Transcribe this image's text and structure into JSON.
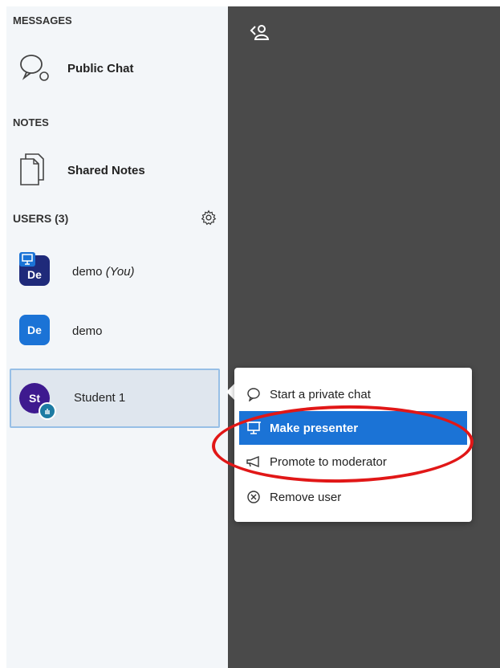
{
  "sidebar": {
    "messages_title": "MESSAGES",
    "public_chat_label": "Public Chat",
    "notes_title": "NOTES",
    "shared_notes_label": "Shared Notes",
    "users_title": "USERS (3)",
    "users": [
      {
        "initials": "De",
        "name": "demo",
        "suffix": "(You)",
        "color": "#1f2a7a"
      },
      {
        "initials": "De",
        "name": "demo",
        "suffix": "",
        "color": "#1b73d6"
      },
      {
        "initials": "St",
        "name": "Student 1",
        "suffix": "",
        "color": "#3e1a8f"
      }
    ]
  },
  "context_menu": {
    "items": [
      {
        "label": "Start a private chat",
        "icon": "chat-bubble-icon"
      },
      {
        "label": "Make presenter",
        "icon": "presentation-icon"
      },
      {
        "label": "Promote to moderator",
        "icon": "megaphone-icon"
      },
      {
        "label": "Remove user",
        "icon": "remove-circle-icon"
      }
    ]
  },
  "colors": {
    "highlight": "#e11717",
    "menu_active": "#1b73d6",
    "main_bg": "#4a4a4a",
    "sidebar_bg": "#f3f6f9"
  }
}
